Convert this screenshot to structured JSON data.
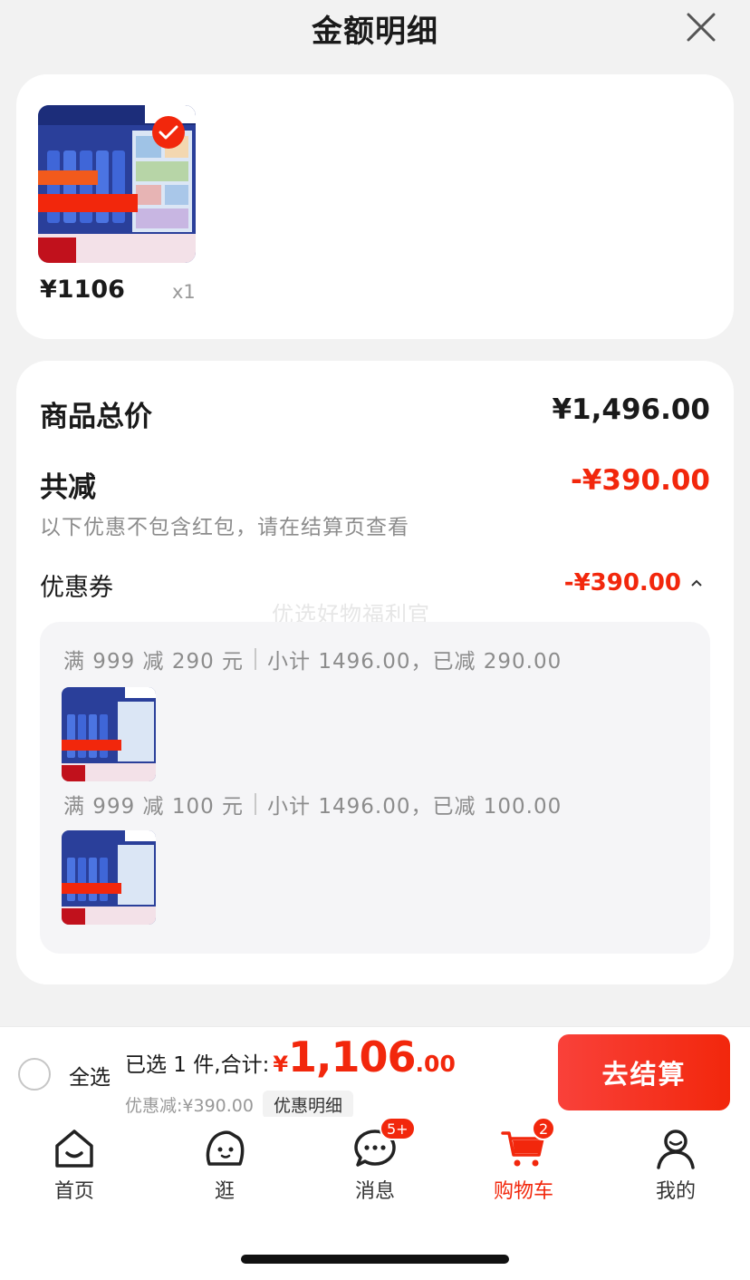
{
  "header": {
    "title": "金额明细",
    "close_icon": "close-icon"
  },
  "product": {
    "price": "¥1106",
    "qty": "x1",
    "thumb_icon": "product-thumbnail",
    "selected": true
  },
  "summary": {
    "total_label": "商品总价",
    "total_value": "¥1,496.00",
    "reduce_label": "共减",
    "reduce_value": "-¥390.00",
    "note": "以下优惠不包含红包，请在结算页查看",
    "coupon_label": "优惠券",
    "coupon_value": "-¥390.00",
    "watermark": "优选好物福利官"
  },
  "coupons": [
    {
      "rule": "满 999 减 290 元",
      "detail": "小计 1496.00，已减 290.00"
    },
    {
      "rule": "满 999 减 100 元",
      "detail": "小计 1496.00，已减 100.00"
    }
  ],
  "bottom_bar": {
    "select_all": "全选",
    "selected_label": "已选 1 件,合计:",
    "currency": "¥",
    "total_int": "1,106",
    "total_dec": ".00",
    "discount_text": "优惠减:¥390.00",
    "detail_pill": "优惠明细",
    "checkout": "去结算"
  },
  "tabs": [
    {
      "label": "首页",
      "icon": "home-icon",
      "active": false
    },
    {
      "label": "逛",
      "icon": "browse-icon",
      "active": false
    },
    {
      "label": "消息",
      "icon": "message-icon",
      "active": false,
      "badge": "5+"
    },
    {
      "label": "购物车",
      "icon": "cart-icon",
      "active": true,
      "badge": "2"
    },
    {
      "label": "我的",
      "icon": "profile-icon",
      "active": false
    }
  ],
  "colors": {
    "accent": "#f2270c",
    "background": "#f2f2f2"
  }
}
